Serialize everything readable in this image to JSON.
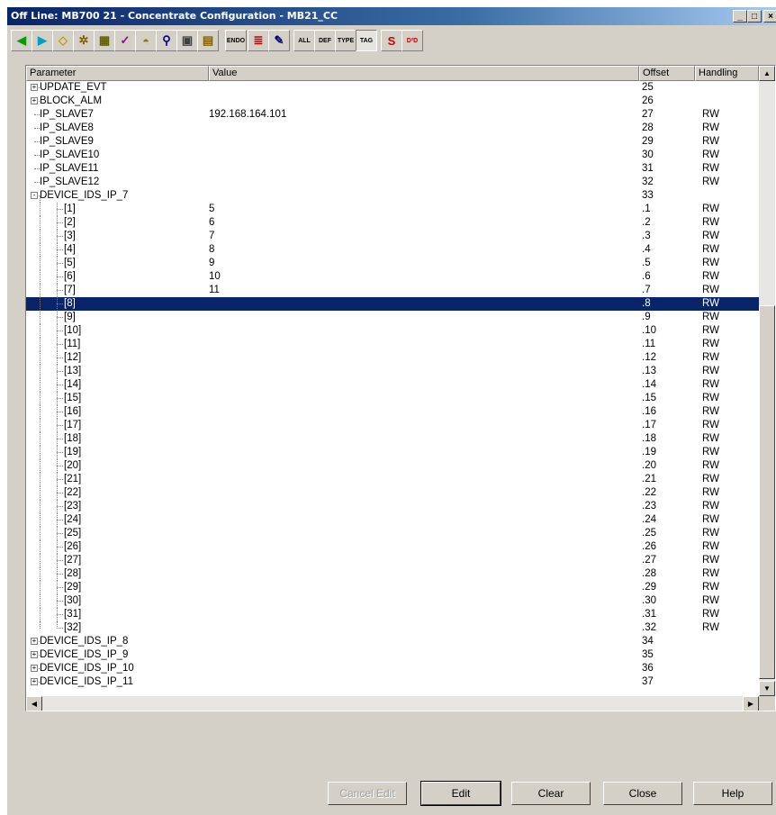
{
  "window": {
    "title": "Off Line: MB700 21 - Concentrate Configuration - MB21_CC",
    "caption_buttons": [
      "_",
      "□",
      "×"
    ]
  },
  "toolbar": {
    "buttons": [
      {
        "icon": "left-arrow-icon",
        "glyph": "◀",
        "color": "#00a000"
      },
      {
        "icon": "right-arrow-icon",
        "glyph": "▶",
        "color": "#00a0c0"
      },
      {
        "icon": "diamond-icon",
        "glyph": "◇",
        "color": "#c0a000"
      },
      {
        "icon": "gear-icon",
        "glyph": "✲",
        "color": "#806000"
      },
      {
        "icon": "device-edit-icon",
        "glyph": "▦",
        "color": "#606000"
      },
      {
        "icon": "wrench-icon",
        "glyph": "✓",
        "color": "#a000a0"
      },
      {
        "icon": "dome-icon",
        "glyph": "◓",
        "color": "#808000"
      },
      {
        "icon": "magnifier-icon",
        "glyph": "⚲",
        "color": "#000080"
      },
      {
        "icon": "calculator-icon",
        "glyph": "▣",
        "color": "#404040"
      },
      {
        "icon": "document-icon",
        "glyph": "▤",
        "color": "#806000"
      },
      {
        "icon": "endo-icon",
        "glyph": "ENDO",
        "color": "#000000"
      },
      {
        "icon": "list-arrow-icon",
        "glyph": "≣",
        "color": "#c00000"
      },
      {
        "icon": "pen-icon",
        "glyph": "✎",
        "color": "#000080"
      },
      {
        "icon": "all-block-icon",
        "glyph": "ALL",
        "color": "#000000"
      },
      {
        "icon": "def-block-icon",
        "glyph": "DEF",
        "color": "#000000"
      },
      {
        "icon": "type-block-icon",
        "glyph": "TYPE",
        "color": "#000000"
      },
      {
        "icon": "tag-block-icon",
        "glyph": "TAG",
        "color": "#000000"
      },
      {
        "icon": "smar-icon",
        "glyph": "S",
        "color": "#d00000"
      },
      {
        "icon": "d2d-icon",
        "glyph": "D²D",
        "color": "#c00000"
      }
    ]
  },
  "table": {
    "columns": [
      "Parameter",
      "Value",
      "Offset",
      "Handling"
    ],
    "rows": [
      {
        "level": 0,
        "expand": "+",
        "param": "UPDATE_EVT",
        "value": "",
        "offset": "25",
        "handling": ""
      },
      {
        "level": 0,
        "expand": "+",
        "param": "BLOCK_ALM",
        "value": "",
        "offset": "26",
        "handling": ""
      },
      {
        "level": 0,
        "expand": "",
        "param": "IP_SLAVE7",
        "value": "192.168.164.101",
        "offset": "27",
        "handling": "RW"
      },
      {
        "level": 0,
        "expand": "",
        "param": "IP_SLAVE8",
        "value": "",
        "offset": "28",
        "handling": "RW"
      },
      {
        "level": 0,
        "expand": "",
        "param": "IP_SLAVE9",
        "value": "",
        "offset": "29",
        "handling": "RW"
      },
      {
        "level": 0,
        "expand": "",
        "param": "IP_SLAVE10",
        "value": "",
        "offset": "30",
        "handling": "RW"
      },
      {
        "level": 0,
        "expand": "",
        "param": "IP_SLAVE11",
        "value": "",
        "offset": "31",
        "handling": "RW"
      },
      {
        "level": 0,
        "expand": "",
        "param": "IP_SLAVE12",
        "value": "",
        "offset": "32",
        "handling": "RW"
      },
      {
        "level": 0,
        "expand": "-",
        "param": "DEVICE_IDS_IP_7",
        "value": "",
        "offset": "33",
        "handling": ""
      },
      {
        "level": 1,
        "expand": "",
        "param": "[1]",
        "value": "5",
        "offset": ".1",
        "handling": "RW"
      },
      {
        "level": 1,
        "expand": "",
        "param": "[2]",
        "value": "6",
        "offset": ".2",
        "handling": "RW"
      },
      {
        "level": 1,
        "expand": "",
        "param": "[3]",
        "value": "7",
        "offset": ".3",
        "handling": "RW"
      },
      {
        "level": 1,
        "expand": "",
        "param": "[4]",
        "value": "8",
        "offset": ".4",
        "handling": "RW"
      },
      {
        "level": 1,
        "expand": "",
        "param": "[5]",
        "value": "9",
        "offset": ".5",
        "handling": "RW"
      },
      {
        "level": 1,
        "expand": "",
        "param": "[6]",
        "value": "10",
        "offset": ".6",
        "handling": "RW"
      },
      {
        "level": 1,
        "expand": "",
        "param": "[7]",
        "value": "11",
        "offset": ".7",
        "handling": "RW"
      },
      {
        "level": 1,
        "expand": "",
        "param": "[8]",
        "value": "",
        "offset": ".8",
        "handling": "RW",
        "selected": true
      },
      {
        "level": 1,
        "expand": "",
        "param": "[9]",
        "value": "",
        "offset": ".9",
        "handling": "RW"
      },
      {
        "level": 1,
        "expand": "",
        "param": "[10]",
        "value": "",
        "offset": ".10",
        "handling": "RW"
      },
      {
        "level": 1,
        "expand": "",
        "param": "[11]",
        "value": "",
        "offset": ".11",
        "handling": "RW"
      },
      {
        "level": 1,
        "expand": "",
        "param": "[12]",
        "value": "",
        "offset": ".12",
        "handling": "RW"
      },
      {
        "level": 1,
        "expand": "",
        "param": "[13]",
        "value": "",
        "offset": ".13",
        "handling": "RW"
      },
      {
        "level": 1,
        "expand": "",
        "param": "[14]",
        "value": "",
        "offset": ".14",
        "handling": "RW"
      },
      {
        "level": 1,
        "expand": "",
        "param": "[15]",
        "value": "",
        "offset": ".15",
        "handling": "RW"
      },
      {
        "level": 1,
        "expand": "",
        "param": "[16]",
        "value": "",
        "offset": ".16",
        "handling": "RW"
      },
      {
        "level": 1,
        "expand": "",
        "param": "[17]",
        "value": "",
        "offset": ".17",
        "handling": "RW"
      },
      {
        "level": 1,
        "expand": "",
        "param": "[18]",
        "value": "",
        "offset": ".18",
        "handling": "RW"
      },
      {
        "level": 1,
        "expand": "",
        "param": "[19]",
        "value": "",
        "offset": ".19",
        "handling": "RW"
      },
      {
        "level": 1,
        "expand": "",
        "param": "[20]",
        "value": "",
        "offset": ".20",
        "handling": "RW"
      },
      {
        "level": 1,
        "expand": "",
        "param": "[21]",
        "value": "",
        "offset": ".21",
        "handling": "RW"
      },
      {
        "level": 1,
        "expand": "",
        "param": "[22]",
        "value": "",
        "offset": ".22",
        "handling": "RW"
      },
      {
        "level": 1,
        "expand": "",
        "param": "[23]",
        "value": "",
        "offset": ".23",
        "handling": "RW"
      },
      {
        "level": 1,
        "expand": "",
        "param": "[24]",
        "value": "",
        "offset": ".24",
        "handling": "RW"
      },
      {
        "level": 1,
        "expand": "",
        "param": "[25]",
        "value": "",
        "offset": ".25",
        "handling": "RW"
      },
      {
        "level": 1,
        "expand": "",
        "param": "[26]",
        "value": "",
        "offset": ".26",
        "handling": "RW"
      },
      {
        "level": 1,
        "expand": "",
        "param": "[27]",
        "value": "",
        "offset": ".27",
        "handling": "RW"
      },
      {
        "level": 1,
        "expand": "",
        "param": "[28]",
        "value": "",
        "offset": ".28",
        "handling": "RW"
      },
      {
        "level": 1,
        "expand": "",
        "param": "[29]",
        "value": "",
        "offset": ".29",
        "handling": "RW"
      },
      {
        "level": 1,
        "expand": "",
        "param": "[30]",
        "value": "",
        "offset": ".30",
        "handling": "RW"
      },
      {
        "level": 1,
        "expand": "",
        "param": "[31]",
        "value": "",
        "offset": ".31",
        "handling": "RW"
      },
      {
        "level": 1,
        "expand": "",
        "param": "[32]",
        "value": "",
        "offset": ".32",
        "handling": "RW"
      },
      {
        "level": 0,
        "expand": "+",
        "param": "DEVICE_IDS_IP_8",
        "value": "",
        "offset": "34",
        "handling": ""
      },
      {
        "level": 0,
        "expand": "+",
        "param": "DEVICE_IDS_IP_9",
        "value": "",
        "offset": "35",
        "handling": ""
      },
      {
        "level": 0,
        "expand": "+",
        "param": "DEVICE_IDS_IP_10",
        "value": "",
        "offset": "36",
        "handling": ""
      },
      {
        "level": 0,
        "expand": "+",
        "param": "DEVICE_IDS_IP_11",
        "value": "",
        "offset": "37",
        "handling": ""
      }
    ]
  },
  "buttons": {
    "cancel_edit": "Cancel Edit",
    "edit": "Edit",
    "clear": "Clear",
    "close": "Close",
    "help": "Help"
  },
  "colors": {
    "selection": "#0a246a",
    "title_start": "#0a246a",
    "title_end": "#a6caf0",
    "face": "#d4d0c8"
  }
}
